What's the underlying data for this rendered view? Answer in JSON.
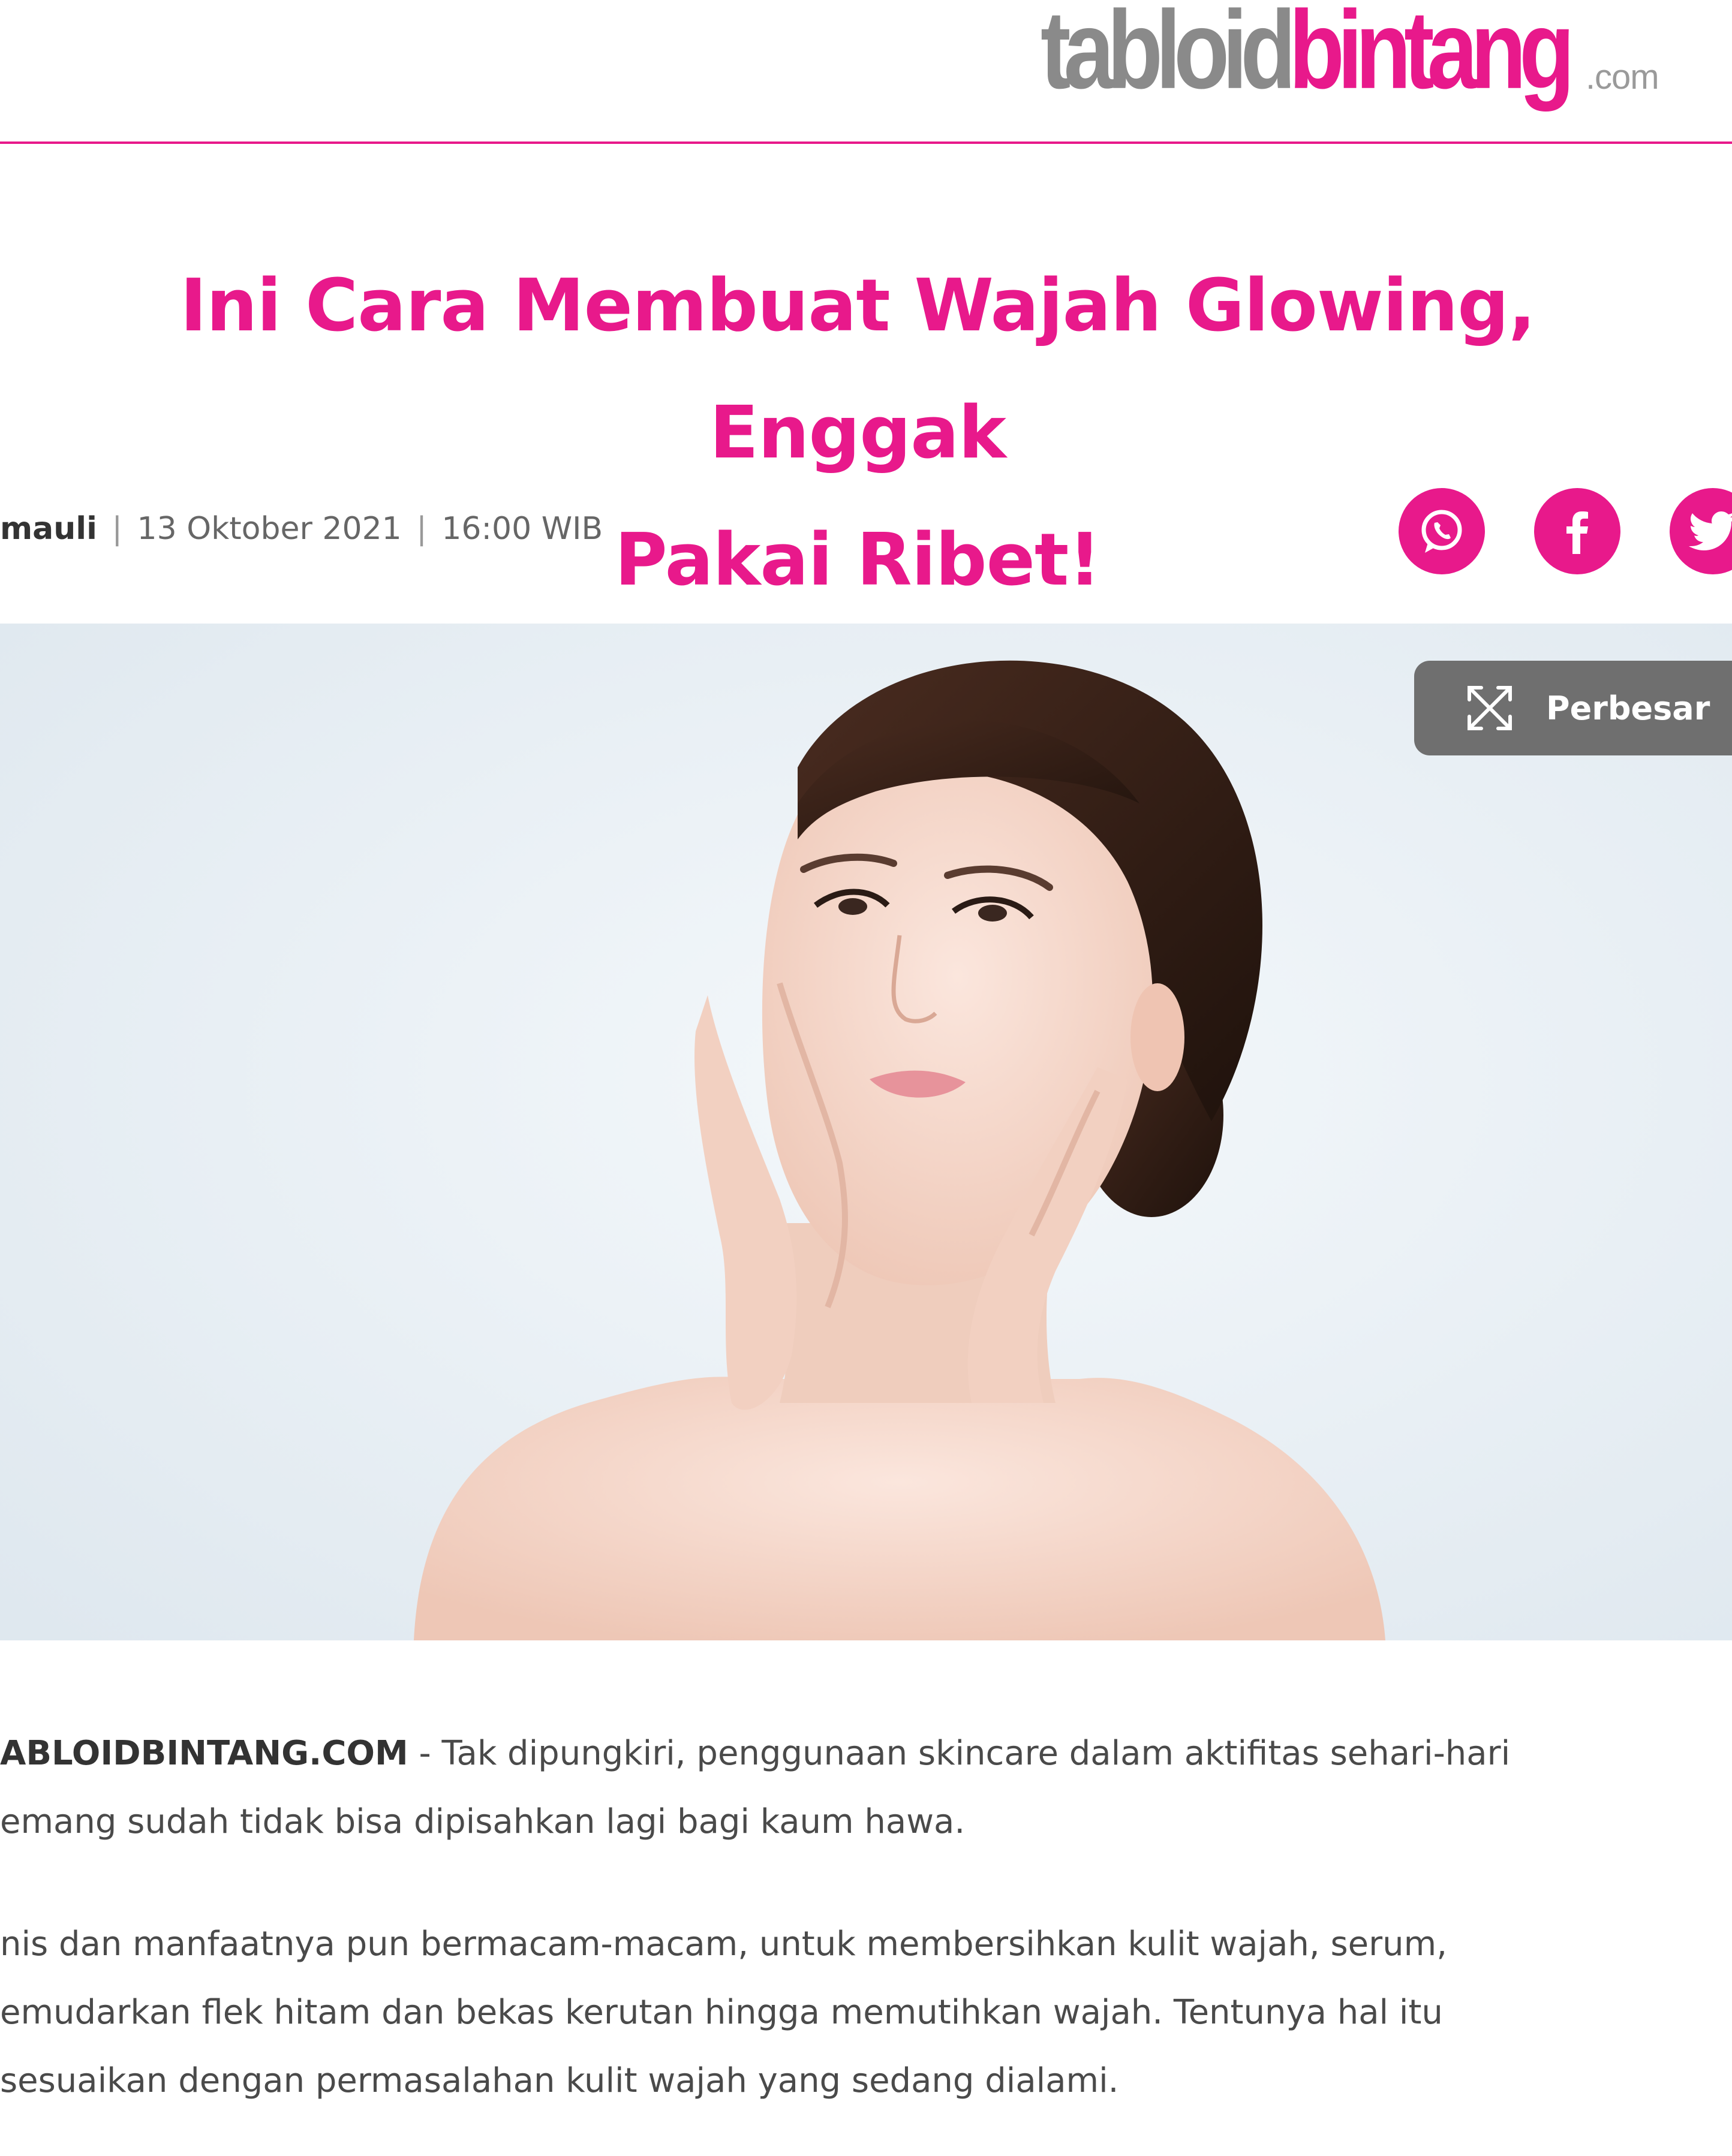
{
  "header": {
    "logo_part1": "tabloid",
    "logo_part2": "bintang",
    "logo_part3": ".com"
  },
  "article": {
    "title_line1": "Ini Cara Membuat Wajah Glowing, Enggak",
    "title_line2": "Pakai Ribet!",
    "author": "mauli",
    "date": "13 Oktober 2021",
    "time": "16:00 WIB",
    "meta_sep": "|"
  },
  "share": {
    "whatsapp_icon": "whatsapp-icon",
    "facebook_icon": "facebook-icon",
    "twitter_icon": "twitter-icon"
  },
  "image": {
    "zoom_label": "Perbesar",
    "zoom_icon": "expand-icon"
  },
  "body": {
    "p1_brand": "ABLOIDBINTANG.COM",
    "p1_line1_rest": " - Tak dipungkiri, penggunaan skincare dalam aktifitas sehari-hari",
    "p1_line2": "emang sudah tidak bisa dipisahkan lagi bagi kaum hawa.",
    "p2_line1": "nis dan manfaatnya pun bermacam-macam, untuk membersihkan kulit wajah, serum,",
    "p2_line2": "emudarkan flek hitam dan bekas kerutan hingga memutihkan wajah. Tentunya hal itu",
    "p2_line3": "sesuaikan dengan permasalahan kulit wajah yang sedang dialami."
  },
  "colors": {
    "brand_pink": "#e8198b",
    "logo_gray": "#8a8a8a",
    "zoom_bg": "#6f6f6f"
  }
}
